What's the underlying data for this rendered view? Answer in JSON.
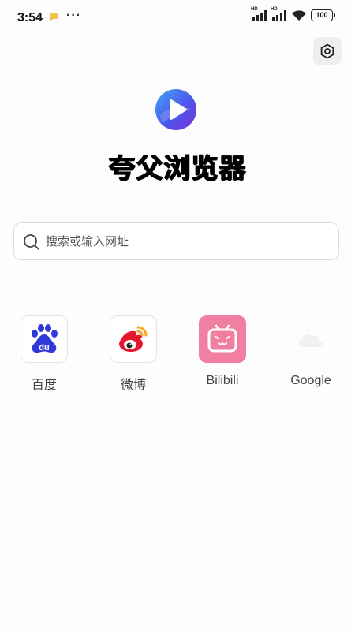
{
  "status_bar": {
    "time": "3:54",
    "dots": "···",
    "battery": "100",
    "hd1": "HD",
    "hd2": "HD"
  },
  "app": {
    "title": "夸父浏览器",
    "logo_icon": "play-logo-icon"
  },
  "search": {
    "placeholder": "搜索或输入网址",
    "value": ""
  },
  "shortcuts": [
    {
      "label": "百度",
      "icon": "baidu-paw-icon"
    },
    {
      "label": "微博",
      "icon": "weibo-eye-icon"
    },
    {
      "label": "Bilibili",
      "icon": "bilibili-tv-icon"
    },
    {
      "label": "Google",
      "icon": "google-cloud-icon"
    }
  ],
  "colors": {
    "accent": "#4a5cf0",
    "bilibili": "#f07fa1",
    "baidu": "#2f39d9",
    "weibo": "#e6162d"
  }
}
